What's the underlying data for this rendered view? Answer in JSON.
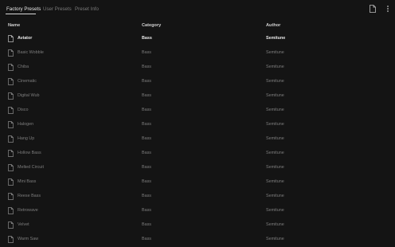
{
  "tabs": [
    {
      "label": "Factory Presets",
      "active": true
    },
    {
      "label": "User Presets",
      "active": false
    },
    {
      "label": "Preset Info",
      "active": false
    }
  ],
  "toolbar": {
    "icons": [
      "new-file-icon",
      "menu-icon"
    ]
  },
  "table": {
    "columns": [
      "Name",
      "Category",
      "Author"
    ],
    "selected_index": 0,
    "rows": [
      {
        "name": "Aviator",
        "category": "Bass",
        "author": "Semitune"
      },
      {
        "name": "Basic Wobble",
        "category": "Bass",
        "author": "Semitune"
      },
      {
        "name": "Chiba",
        "category": "Bass",
        "author": "Semitune"
      },
      {
        "name": "Cinematic",
        "category": "Bass",
        "author": "Semitune"
      },
      {
        "name": "Digital Wub",
        "category": "Bass",
        "author": "Semitune"
      },
      {
        "name": "Disco",
        "category": "Bass",
        "author": "Semitune"
      },
      {
        "name": "Halogen",
        "category": "Bass",
        "author": "Semitune"
      },
      {
        "name": "Hang Up",
        "category": "Bass",
        "author": "Semitune"
      },
      {
        "name": "Hollow Bass",
        "category": "Bass",
        "author": "Semitune"
      },
      {
        "name": "Melted Circuit",
        "category": "Bass",
        "author": "Semitune"
      },
      {
        "name": "Mini Bass",
        "category": "Bass",
        "author": "Semitune"
      },
      {
        "name": "Reese Bass",
        "category": "Bass",
        "author": "Semitune"
      },
      {
        "name": "Retrowave",
        "category": "Bass",
        "author": "Semitune"
      },
      {
        "name": "Velvet",
        "category": "Bass",
        "author": "Semitune"
      },
      {
        "name": "Warm Saw",
        "category": "Bass",
        "author": "Semitune"
      }
    ]
  }
}
